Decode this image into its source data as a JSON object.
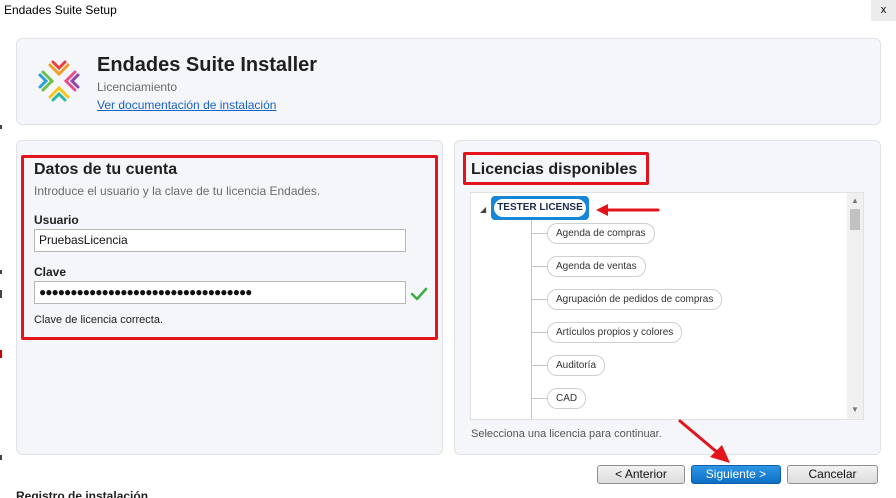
{
  "window": {
    "title": "Endades Suite Setup",
    "close_label": "x"
  },
  "header": {
    "title": "Endades Suite Installer",
    "subtitle": "Licenciamiento",
    "doc_link": "Ver documentación de instalación"
  },
  "account": {
    "title": "Datos de tu cuenta",
    "description": "Introduce el usuario y la clave de tu licencia Endades.",
    "user_label": "Usuario",
    "user_value": "PruebasLicencia",
    "key_label": "Clave",
    "key_value": "●●●●●●●●●●●●●●●●●●●●●●●●●●●●●●●●●●",
    "status": "Clave de licencia correcta."
  },
  "licenses": {
    "title": "Licencias disponibles",
    "root": "TESTER LICENSE",
    "items": [
      "Agenda de compras",
      "Agenda de ventas",
      "Agrupación de pedidos de compras",
      "Artículos propios y colores",
      "Auditoría",
      "CAD"
    ],
    "hint": "Selecciona una licencia para continuar."
  },
  "buttons": {
    "prev": "< Anterior",
    "next": "Siguiente >",
    "cancel": "Cancelar"
  },
  "footer": {
    "label": "Registro de instalación"
  },
  "colors": {
    "accent": "#1687d8",
    "highlight": "#e3141b",
    "success": "#3cb043",
    "link": "#1a63c6"
  }
}
